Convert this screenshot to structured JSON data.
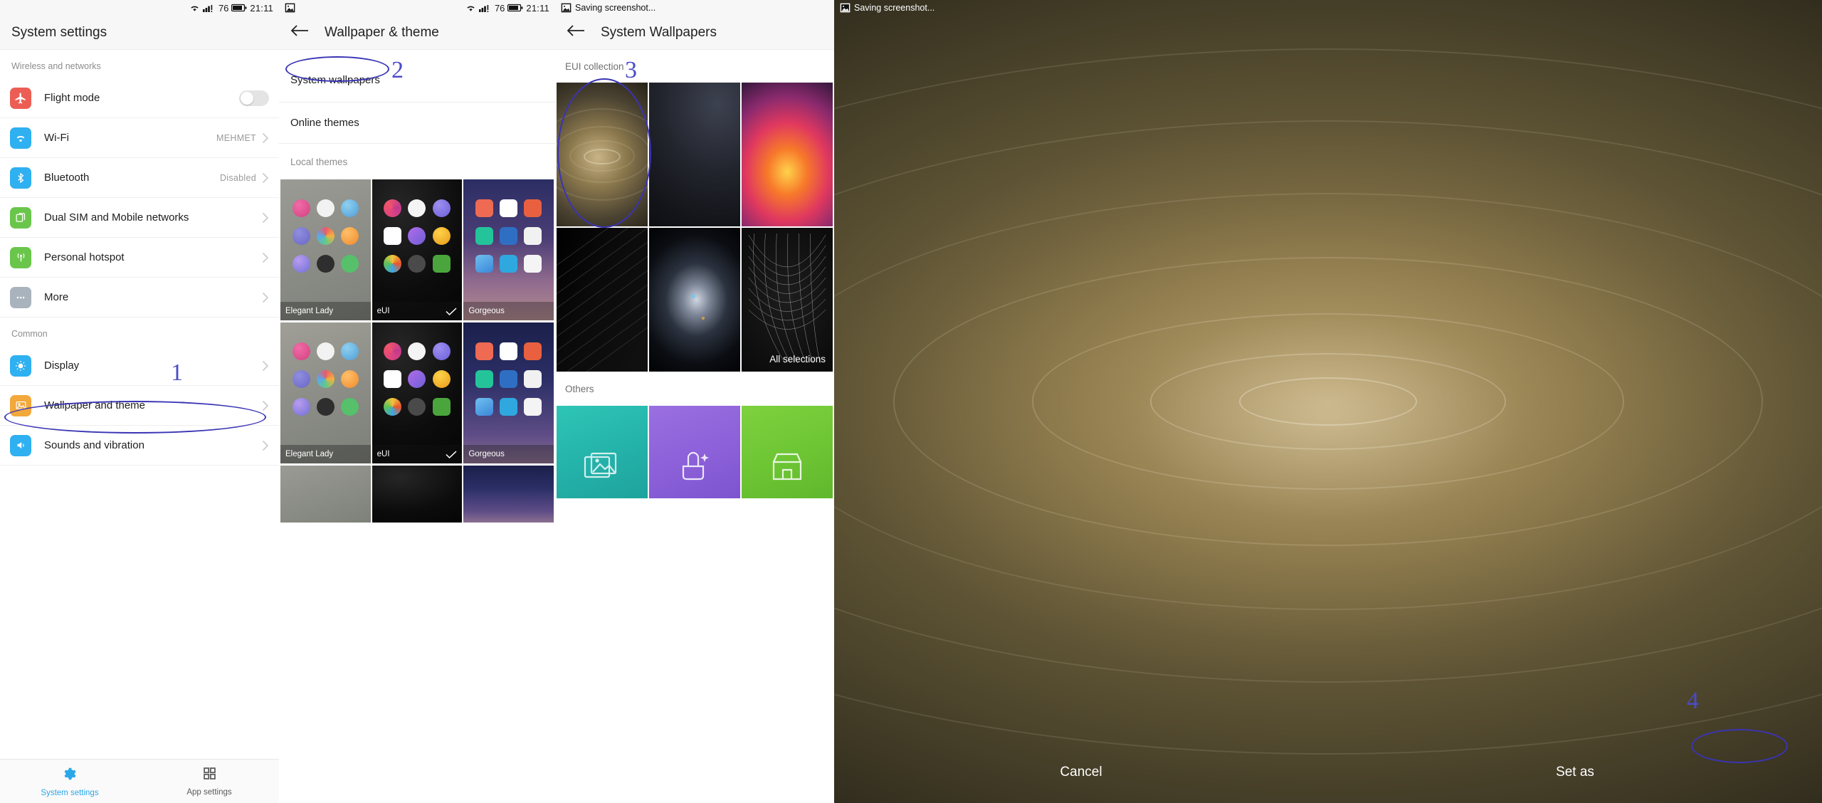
{
  "statusbar": {
    "wifi_icon": "wifi-icon",
    "signal_icon": "signal-icon",
    "battery_level": "76",
    "battery_icon": "battery-icon",
    "time": "21:11",
    "screenshot_note": "Saving screenshot...",
    "screenshot_icon": "image-icon"
  },
  "panel1": {
    "title": "System settings",
    "groups": [
      {
        "label": "Wireless and networks",
        "rows": [
          {
            "icon": "airplane-icon",
            "label": "Flight mode",
            "value": "",
            "control": "toggle",
            "color": "#ec5e54"
          },
          {
            "icon": "wifi-icon",
            "label": "Wi-Fi",
            "value": "MEHMET",
            "control": "chevron",
            "color": "#2fb0f0"
          },
          {
            "icon": "bluetooth-icon",
            "label": "Bluetooth",
            "value": "Disabled",
            "control": "chevron",
            "color": "#2fb0f0"
          },
          {
            "icon": "sim-card-icon",
            "label": "Dual SIM and Mobile networks",
            "value": "",
            "control": "chevron",
            "color": "#6ac64b"
          },
          {
            "icon": "hotspot-icon",
            "label": "Personal hotspot",
            "value": "",
            "control": "chevron",
            "color": "#6ac64b"
          },
          {
            "icon": "more-dots-icon",
            "label": "More",
            "value": "",
            "control": "chevron",
            "color": "#a9b3bd"
          }
        ]
      },
      {
        "label": "Common",
        "rows": [
          {
            "icon": "brightness-icon",
            "label": "Display",
            "value": "",
            "control": "chevron",
            "color": "#2fb0f0"
          },
          {
            "icon": "wallpaper-icon",
            "label": "Wallpaper and theme",
            "value": "",
            "control": "chevron",
            "color": "#f2a83b"
          },
          {
            "icon": "sound-icon",
            "label": "Sounds and vibration",
            "value": "",
            "control": "chevron",
            "color": "#2fb0f0"
          }
        ]
      }
    ],
    "tabs": [
      {
        "icon": "gear-icon",
        "label": "System settings",
        "active": true
      },
      {
        "icon": "grid-icon",
        "label": "App settings",
        "active": false
      }
    ]
  },
  "panel2": {
    "title": "Wallpaper & theme",
    "back_icon": "back-arrow-icon",
    "rows": [
      {
        "label": "System wallpapers"
      },
      {
        "label": "Online themes"
      }
    ],
    "section_label": "Local themes",
    "themes_row1": [
      {
        "name": "Elegant Lady",
        "selected": false
      },
      {
        "name": "eUI",
        "selected": true
      },
      {
        "name": "Gorgeous",
        "selected": false
      }
    ],
    "themes_row2": [
      {
        "name": "Elegant Lady",
        "selected": false
      },
      {
        "name": "eUI",
        "selected": true
      },
      {
        "name": "Gorgeous",
        "selected": false
      }
    ]
  },
  "panel3": {
    "title": "System Wallpapers",
    "back_icon": "back-arrow-icon",
    "section_eui": "EUI collection",
    "section_others": "Others",
    "all_selections_label": "All selections",
    "wallpapers": [
      {
        "id": "ripple-gold"
      },
      {
        "id": "dark-curve"
      },
      {
        "id": "fire-nebula"
      },
      {
        "id": "diagonal-rays"
      },
      {
        "id": "earth-space"
      },
      {
        "id": "spiral-lines"
      }
    ],
    "others": [
      {
        "id": "gallery-teal",
        "icon": "gallery-icon"
      },
      {
        "id": "magic-purple",
        "icon": "wand-icon"
      },
      {
        "id": "store-green",
        "icon": "store-icon"
      }
    ]
  },
  "panel4": {
    "cancel_label": "Cancel",
    "set_as_label": "Set as"
  },
  "annotations": {
    "accent": "#3a34b5",
    "marks": [
      {
        "number": "1",
        "target": "display-row"
      },
      {
        "number": "2",
        "target": "system-wallpapers-row"
      },
      {
        "number": "3",
        "target": "first-wallpaper-cell"
      },
      {
        "number": "4",
        "target": "set-as-button"
      }
    ],
    "n1": "1",
    "n2": "2",
    "n3": "3",
    "n4": "4"
  }
}
